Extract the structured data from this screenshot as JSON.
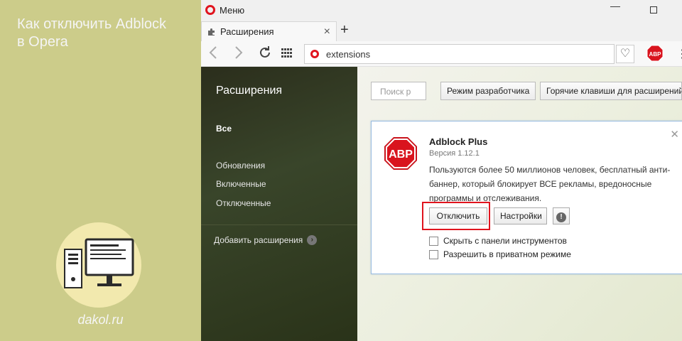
{
  "promo": {
    "title_line1": "Как отключить Adblock",
    "title_line2": "в Opera",
    "site": "dakol.ru"
  },
  "window": {
    "menu_label": "Меню",
    "minimize": "—",
    "close": "✕"
  },
  "tab": {
    "label": "Расширения",
    "close": "×",
    "new_tab": "+"
  },
  "address": {
    "url": "extensions",
    "badge": "ABP"
  },
  "sidebar": {
    "title": "Расширения",
    "items": [
      {
        "label": "Все"
      },
      {
        "label": "Обновления"
      },
      {
        "label": "Включенные"
      },
      {
        "label": "Отключенные"
      }
    ],
    "add_label": "Добавить расширения"
  },
  "toolbar": {
    "search_placeholder": "Поиск р",
    "dev_mode_label": "Режим разработчика",
    "hotkeys_label": "Горячие клавиши для расширений"
  },
  "extension": {
    "logo_text": "ABP",
    "name": "Adblock Plus",
    "version": "Версия 1.12.1",
    "description": "Пользуются более 50 миллионов человек, бесплатный анти-баннер, который блокирует ВСЕ рекламы, вредоносные программы и отслеживания.",
    "disable_label": "Отключить",
    "settings_label": "Настройки",
    "info_label": "!",
    "hide_toolbar_label": "Скрыть с панели инструментов",
    "private_mode_label": "Разрешить в приватном режиме"
  },
  "colors": {
    "opera_red": "#e0141e",
    "promo_bg": "#cccc8a",
    "sidebar_bg": "#2b2e1c",
    "highlight": "#e0141e"
  },
  "icons": [
    "opera-logo-icon",
    "puzzle-icon",
    "back-arrow-icon",
    "forward-arrow-icon",
    "reload-icon",
    "speed-dial-grid-icon",
    "heart-icon",
    "abp-extension-icon",
    "computer-icon",
    "info-icon",
    "chevron-right-icon"
  ]
}
